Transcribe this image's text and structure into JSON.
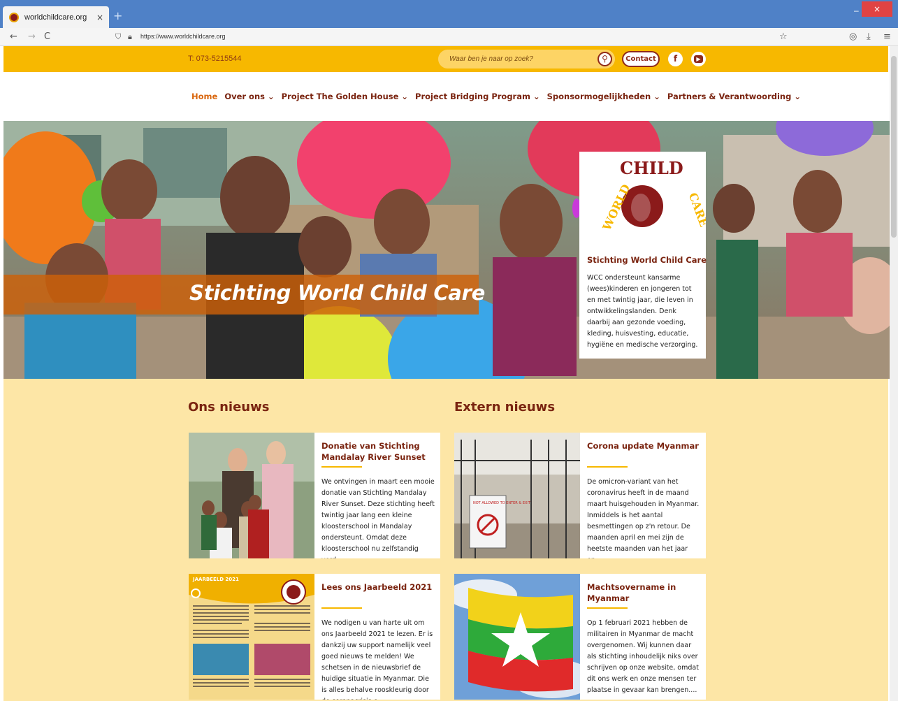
{
  "browser": {
    "tab_title": "worldchildcare.org",
    "url": "https://www.worldchildcare.org",
    "tab_close": "×",
    "new_tab": "+",
    "back": "←",
    "forward": "→",
    "reload": "C",
    "bookmark": "☆",
    "pocket": "◎",
    "download": "⤓",
    "menu": "≡",
    "win_minimize": "–",
    "win_maximize": "□",
    "win_close": "×"
  },
  "topbar": {
    "phone": "T: 073-5215544",
    "search_placeholder": "Waar ben je naar op zoek?",
    "search_icon": "⚲",
    "contact": "Contact",
    "facebook": "f",
    "youtube": "▶"
  },
  "nav": {
    "items": [
      {
        "label": "Home"
      },
      {
        "label": "Over ons ⌄"
      },
      {
        "label": "Project The Golden House ⌄"
      },
      {
        "label": "Project Bridging Program ⌄"
      },
      {
        "label": "Sponsormogelijkheden ⌄"
      },
      {
        "label": "Partners & Verantwoording ⌄"
      }
    ]
  },
  "hero": {
    "title": "Stichting World Child Care",
    "card_title": "Stichting World Child Care",
    "card_text": "WCC ondersteunt kansarme (wees)kinderen en jongeren tot en met twintig jaar, die leven in ontwikkelingslanden. Denk daarbij aan gezonde voeding, kleding, huisvesting, educatie, hygiëne en medische verzorging.",
    "logo_top": "CHILD",
    "logo_left": "WORLD",
    "logo_right": "CARE"
  },
  "sections": {
    "ons_nieuws": "Ons nieuws",
    "extern_nieuws": "Extern nieuws"
  },
  "news": [
    {
      "title": "Donatie van Stichting Mandalay River Sunset",
      "text": "We ontvingen in maart een mooie donatie van Stichting Mandalay River Sunset. Deze stichting heeft twintig jaar lang een kleine kloosterschool in Mandalay ondersteunt. Omdat deze kloosterschool nu zelfstandig verd..."
    },
    {
      "title": "Corona update Myanmar",
      "text": "De omicron-variant van het coronavirus heeft in de maand maart huisgehouden in Myanmar. Inmiddels is het aantal besmettingen op z'n retour. De maanden april en mei zijn de heetste maanden van het jaar en...",
      "sign_text": "NOT ALLOWED TO ENTER & EXIT"
    },
    {
      "title": "Lees ons Jaarbeeld 2021",
      "text": "We nodigen u van harte uit om ons Jaarbeeld 2021 te lezen. Er is dankzij uw support namelijk veel goed nieuws te melden! We schetsen in de nieuwsbrief de huidige situatie in Myanmar. Die is alles behalve rooskleurig door de coronacrisis e...",
      "doc_header": "JAARBEELD 2021"
    },
    {
      "title": "Machtsovername in Myanmar",
      "text": "Op 1 februari 2021 hebben de militairen in Myanmar de macht overgenomen. Wij kunnen daar als stichting inhoudelijk niks over schrijven op onze website, omdat dit ons werk en onze mensen ter plaatse in gevaar kan brengen...."
    }
  ]
}
